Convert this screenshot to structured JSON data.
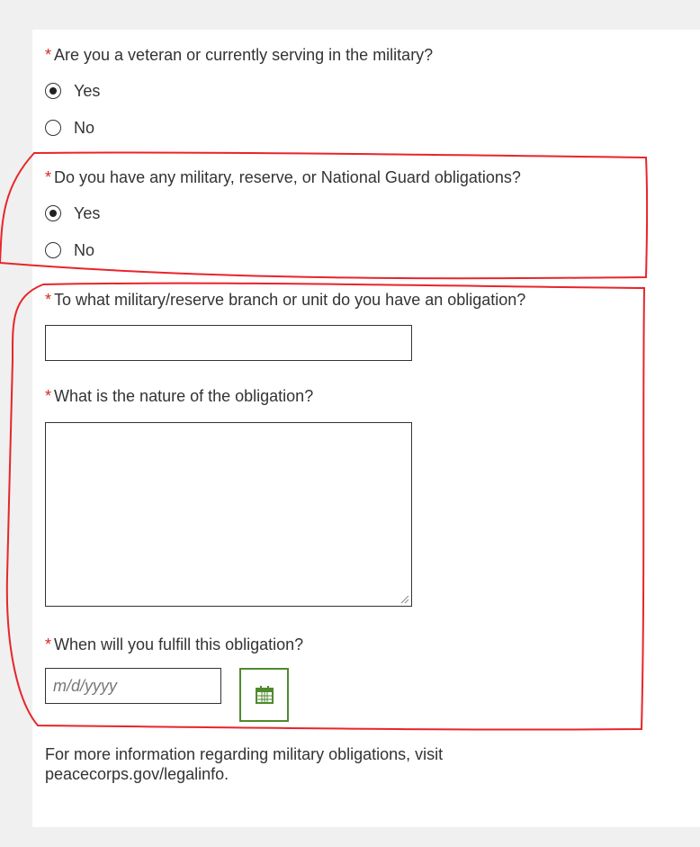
{
  "form": {
    "q1": {
      "required_mark": "*",
      "label": "Are you a veteran or currently serving in the military?",
      "options": [
        "Yes",
        "No"
      ],
      "selected": "Yes"
    },
    "q2": {
      "required_mark": "*",
      "label": "Do you have any military, reserve, or National Guard obligations?",
      "options": [
        "Yes",
        "No"
      ],
      "selected": "Yes"
    },
    "q3": {
      "required_mark": "*",
      "label": "To what military/reserve branch or unit do you have an obligation?",
      "value": ""
    },
    "q4": {
      "required_mark": "*",
      "label": "What is the nature of the obligation?",
      "value": ""
    },
    "q5": {
      "required_mark": "*",
      "label": "When will you fulfill this obligation?",
      "placeholder": "m/d/yyyy",
      "value": "",
      "calendar_icon": "calendar-icon"
    },
    "info": {
      "text": "For more information regarding military obligations, visit",
      "link": "peacecorps.gov/legalinfo",
      "suffix": "."
    }
  },
  "colors": {
    "required": "#d9261c",
    "text": "#333333",
    "calendar_accent": "#4f8a2f",
    "annotation": "#e8252a",
    "page_background": "#f0f0f0",
    "panel_background": "#ffffff"
  }
}
